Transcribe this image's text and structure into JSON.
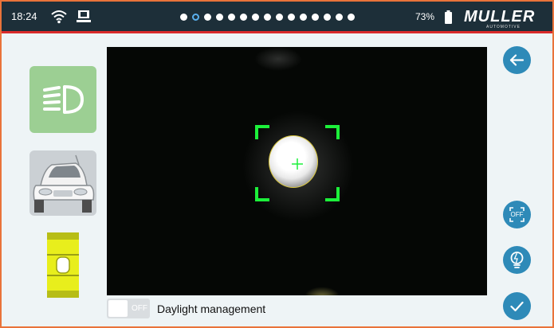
{
  "status_bar": {
    "time": "18:24",
    "battery_percent": "73%",
    "page_dots_total": 15,
    "page_dots_active_index": 1,
    "brand": "MULLER",
    "brand_subtitle": "AUTOMOTIVE"
  },
  "icons": {
    "wifi": "wifi-icon",
    "device": "device-icon",
    "battery": "battery-icon",
    "headlight": "headlight-icon",
    "car": "car-icon",
    "level": "level-icon",
    "back": "arrow-left-icon",
    "bulb": "bulb-icon",
    "check": "check-icon"
  },
  "controls": {
    "off_button_label": "OFF",
    "daylight_toggle_state": "OFF",
    "daylight_label": "Daylight management"
  },
  "colors": {
    "status_bar_bg": "#1d2f39",
    "accent_red": "#d92b2b",
    "accent_blue": "#2e8ab8",
    "headlight_tile": "#9ccf93",
    "target_green": "#1cf03a",
    "level_yellow": "#e8ee1c"
  }
}
